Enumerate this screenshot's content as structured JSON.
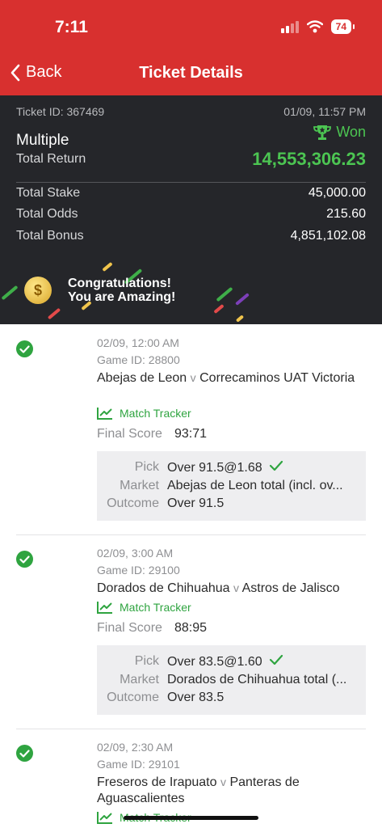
{
  "status_bar": {
    "time": "7:11",
    "battery": "74"
  },
  "nav": {
    "back_label": "Back",
    "title": "Ticket Details"
  },
  "ticket": {
    "id_label": "Ticket ID: 367469",
    "date": "01/09, 11:57 PM",
    "status": "Won",
    "type": "Multiple",
    "total_return_label": "Total Return",
    "total_return": "14,553,306.23",
    "rows": [
      {
        "label": "Total Stake",
        "value": "45,000.00"
      },
      {
        "label": "Total Odds",
        "value": "215.60"
      },
      {
        "label": "Total Bonus",
        "value": "4,851,102.08"
      }
    ],
    "congrats_line1": "Congratulations!",
    "congrats_line2": "You are Amazing!",
    "coin_symbol": "$"
  },
  "labels": {
    "match_tracker": "Match Tracker",
    "final_score": "Final Score",
    "pick": "Pick",
    "market": "Market",
    "outcome": "Outcome",
    "vs": "v"
  },
  "selections": [
    {
      "date": "02/09, 12:00 AM",
      "game_id": "Game ID: 28800",
      "home": "Abejas de Leon",
      "away": "Correcaminos UAT Victoria",
      "final_score": "93:71",
      "pick": "Over 91.5@1.68",
      "market": "Abejas de Leon total (incl. ov...",
      "outcome": "Over 91.5"
    },
    {
      "date": "02/09, 3:00 AM",
      "game_id": "Game ID: 29100",
      "home": "Dorados de Chihuahua",
      "away": "Astros de Jalisco",
      "final_score": "88:95",
      "pick": "Over 83.5@1.60",
      "market": "Dorados de Chihuahua total (...",
      "outcome": "Over 83.5"
    },
    {
      "date": "02/09, 2:30 AM",
      "game_id": "Game ID: 29101",
      "home": "Freseros de Irapuato",
      "away": "Panteras de Aguascalientes"
    }
  ],
  "colors": {
    "header": "#d8302f",
    "summary_bg": "#25262a",
    "win_green": "#4cc552",
    "check_green": "#2fa440"
  },
  "icons": [
    "chevron-left-icon",
    "trophy-icon",
    "check-circle-icon",
    "chart-line-icon",
    "checkmark-icon",
    "coin-icon",
    "signal-icon",
    "wifi-icon",
    "battery-icon"
  ]
}
